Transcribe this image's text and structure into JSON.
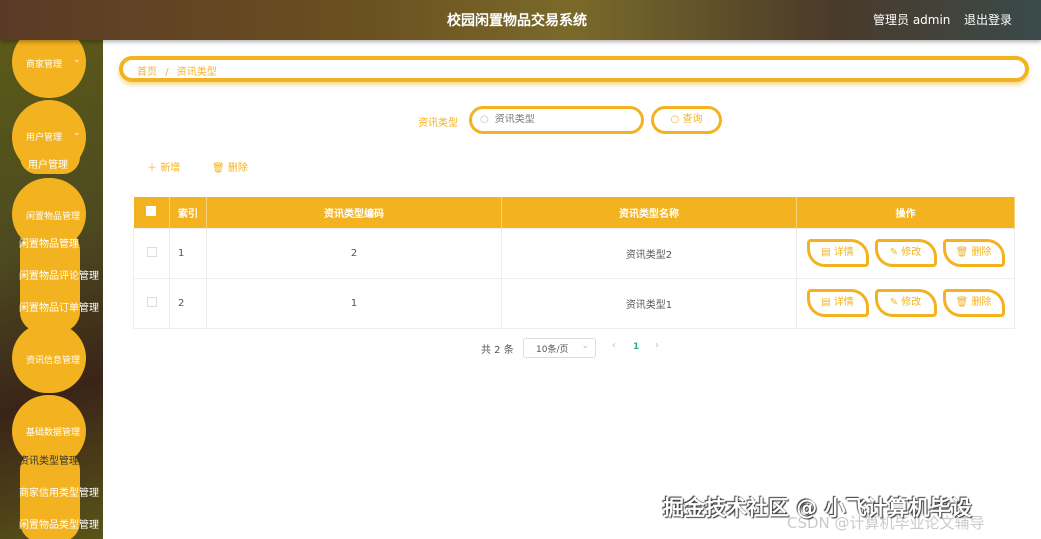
{
  "header": {
    "title": "校园闲置物品交易系统",
    "user": "管理员 admin",
    "logout": "退出登录"
  },
  "sidebar": {
    "menus": [
      {
        "label": "商家管理"
      },
      {
        "label": "用户管理",
        "children": [
          "用户管理"
        ]
      },
      {
        "label": "闲置物品管理",
        "children": [
          "闲置物品管理",
          "闲置物品评论管理",
          "闲置物品订单管理"
        ]
      },
      {
        "label": "资讯信息管理"
      },
      {
        "label": "基础数据管理",
        "children": [
          "资讯类型管理",
          "商家信用类型管理",
          "闲置物品类型管理"
        ]
      }
    ]
  },
  "breadcrumb": {
    "home": "首页",
    "sep": "/",
    "current": "资讯类型"
  },
  "search": {
    "label": "资讯类型",
    "placeholder": "资讯类型",
    "button": "查询"
  },
  "toolbar": {
    "add": "新增",
    "delete": "删除"
  },
  "table": {
    "headers": [
      "索引",
      "资讯类型编码",
      "资讯类型名称",
      "操作"
    ],
    "rows": [
      {
        "index": "1",
        "code": "2",
        "name": "资讯类型2"
      },
      {
        "index": "2",
        "code": "1",
        "name": "资讯类型1"
      }
    ],
    "actions": {
      "detail": "详情",
      "edit": "修改",
      "delete": "删除"
    }
  },
  "pagination": {
    "total": "共 2 条",
    "page_size": "10条/页",
    "current_page": "1"
  },
  "watermark": {
    "main": "掘金技术社区 @ 小飞计算机毕设",
    "sub": "CSDN @计算机毕业论文辅导"
  },
  "colors": {
    "accent": "#f3b320"
  }
}
